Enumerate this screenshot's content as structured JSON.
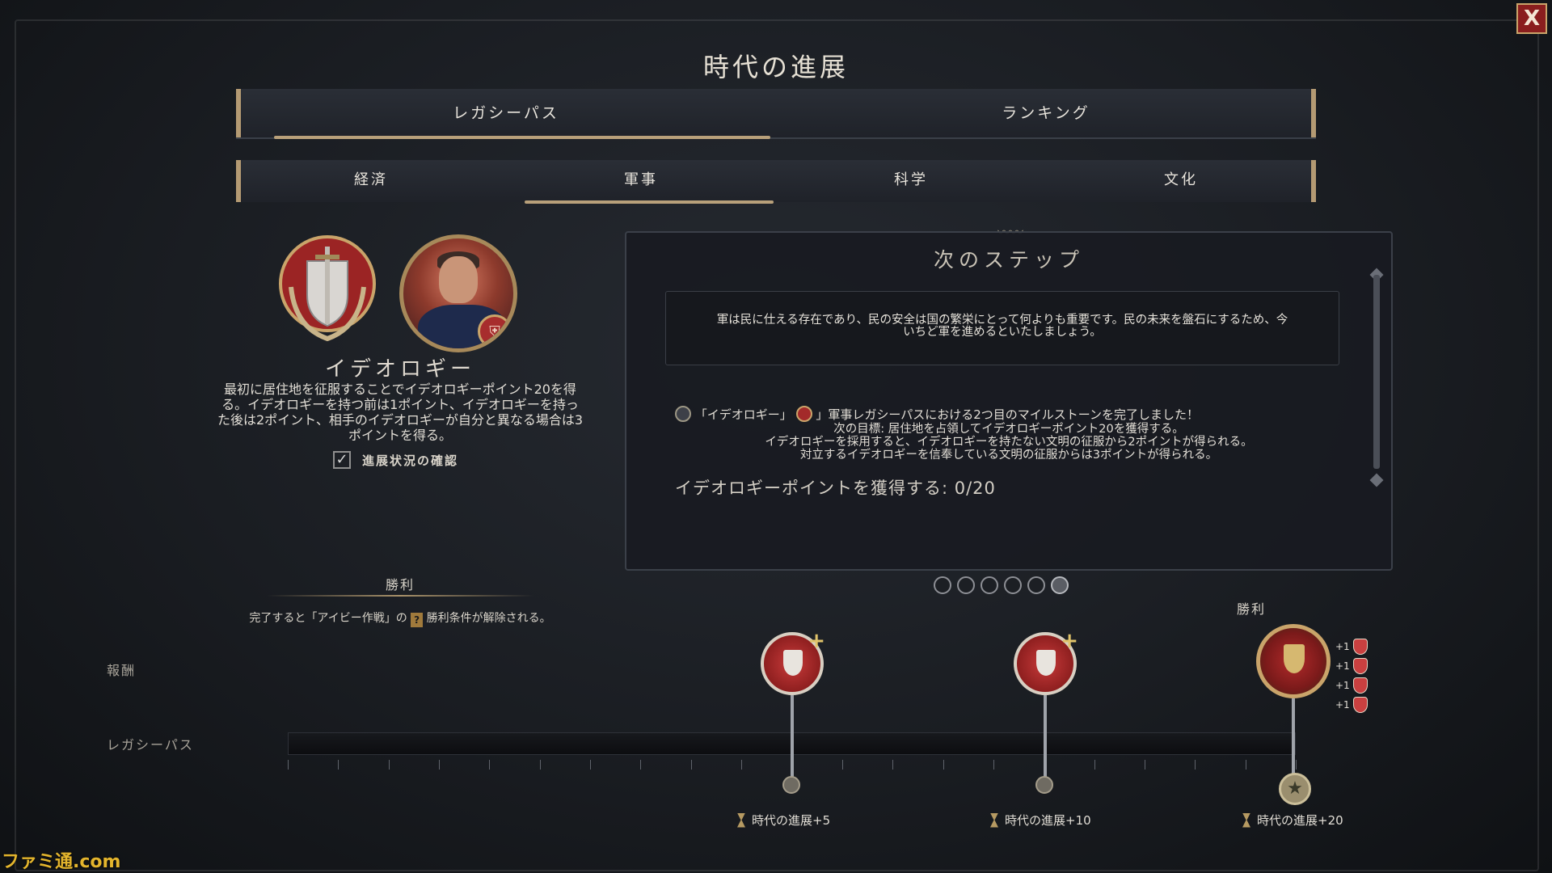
{
  "header": {
    "title": "時代の進展",
    "close_label": "X"
  },
  "main_tabs": [
    {
      "label": "レガシーパス",
      "active": true
    },
    {
      "label": "ランキング",
      "active": false
    }
  ],
  "sub_tabs": [
    {
      "label": "経済"
    },
    {
      "label": "軍事",
      "active": true
    },
    {
      "label": "科学"
    },
    {
      "label": "文化"
    }
  ],
  "ideology": {
    "title": "イデオロギー",
    "description_lines": [
      "最初に居住地を征服することでイデオロギーポイント20を得",
      "る。イデオロギーを持つ前は1ポイント、イデオロギーを持っ",
      "た後は2ポイント、相手のイデオロギーが自分と異なる場合は3",
      "ポイントを得る。"
    ],
    "progress_check_label": "進展状況の確認"
  },
  "victory": {
    "heading": "勝利",
    "desc_before": "完了すると「アイビー作戦」の",
    "desc_after": "勝利条件が解除される。"
  },
  "next_step": {
    "title": "次のステップ",
    "quote_lines": [
      "軍は民に仕える存在であり、民の安全は国の繁栄にとって何よりも重要です。民の未来を盤石にするため、今",
      "いちど軍を進めるといたしましょう。"
    ],
    "milestone_prefix": "「イデオロギー」",
    "milestone_suffix": "」軍事レガシーパスにおける2つ目のマイルストーンを完了しました！",
    "sub_lines": [
      "次の目標: 居住地を占領してイデオロギーポイント20を獲得する。",
      "イデオロギーを採用すると、イデオロギーを持たない文明の征服から2ポイントが得られる。",
      "対立するイデオロギーを信奉している文明の征服からは3ポイントが得られる。"
    ],
    "points_text": "イデオロギーポイントを獲得する: 0/20",
    "page_count": 6,
    "active_page": 6
  },
  "legacy_path": {
    "rewards_label": "報酬",
    "path_label": "レガシーパス",
    "victory_label": "勝利",
    "milestones": [
      {
        "era_label": "時代の進展+5"
      },
      {
        "era_label": "時代の進展+10"
      },
      {
        "era_label": "時代の進展+20"
      }
    ],
    "final_rewards": [
      "+1",
      "+1",
      "+1",
      "+1"
    ]
  },
  "colors": {
    "accent_gold": "#b8a07a",
    "reward_red": "#c83a3a",
    "close_red": "#8a1e1e"
  },
  "watermark": "ファミ通.com"
}
